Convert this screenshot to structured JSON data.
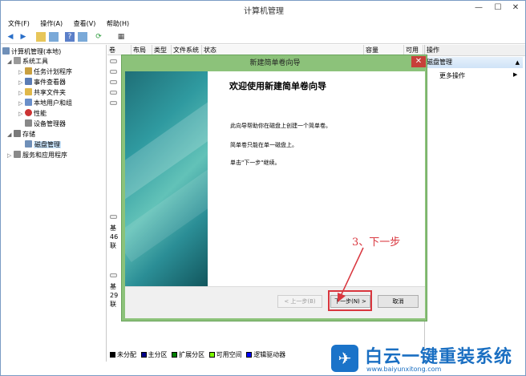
{
  "window": {
    "title": "计算机管理"
  },
  "menu": [
    "文件(F)",
    "操作(A)",
    "查看(V)",
    "帮助(H)"
  ],
  "tree": {
    "root": "计算机管理(本地)",
    "system_tools": "系统工具",
    "items": [
      "任务计划程序",
      "事件查看器",
      "共享文件夹",
      "本地用户和组",
      "性能",
      "设备管理器"
    ],
    "storage": "存储",
    "disk_mgmt": "磁盘管理",
    "services": "服务和应用程序"
  },
  "columns": [
    "卷",
    "布局",
    "类型",
    "文件系统",
    "状态",
    "容量",
    "可用"
  ],
  "disks": [
    {
      "l1": "基",
      "l2": "46",
      "l3": "联"
    },
    {
      "l1": "基",
      "l2": "29",
      "l3": "联"
    }
  ],
  "legend": [
    "未分配",
    "主分区",
    "扩展分区",
    "可用空间",
    "逻辑驱动器"
  ],
  "legend_colors": [
    "#000000",
    "#00008b",
    "#008000",
    "#7cfc00",
    "#0000ff"
  ],
  "actions": {
    "header": "操作",
    "sub": "磁盘管理",
    "more": "更多操作"
  },
  "wizard": {
    "title": "新建简单卷向导",
    "heading": "欢迎使用新建简单卷向导",
    "p1": "此向导帮助你在磁盘上创建一个简单卷。",
    "p2": "简单卷只能在单一磁盘上。",
    "p3": "单击\"下一步\"继续。",
    "back": "< 上一步(B)",
    "next": "下一步(N) >",
    "cancel": "取消"
  },
  "annotation": "3、下一步",
  "watermark": {
    "brand": "白云一键重装系统",
    "url": "www.baiyunxitong.com"
  }
}
